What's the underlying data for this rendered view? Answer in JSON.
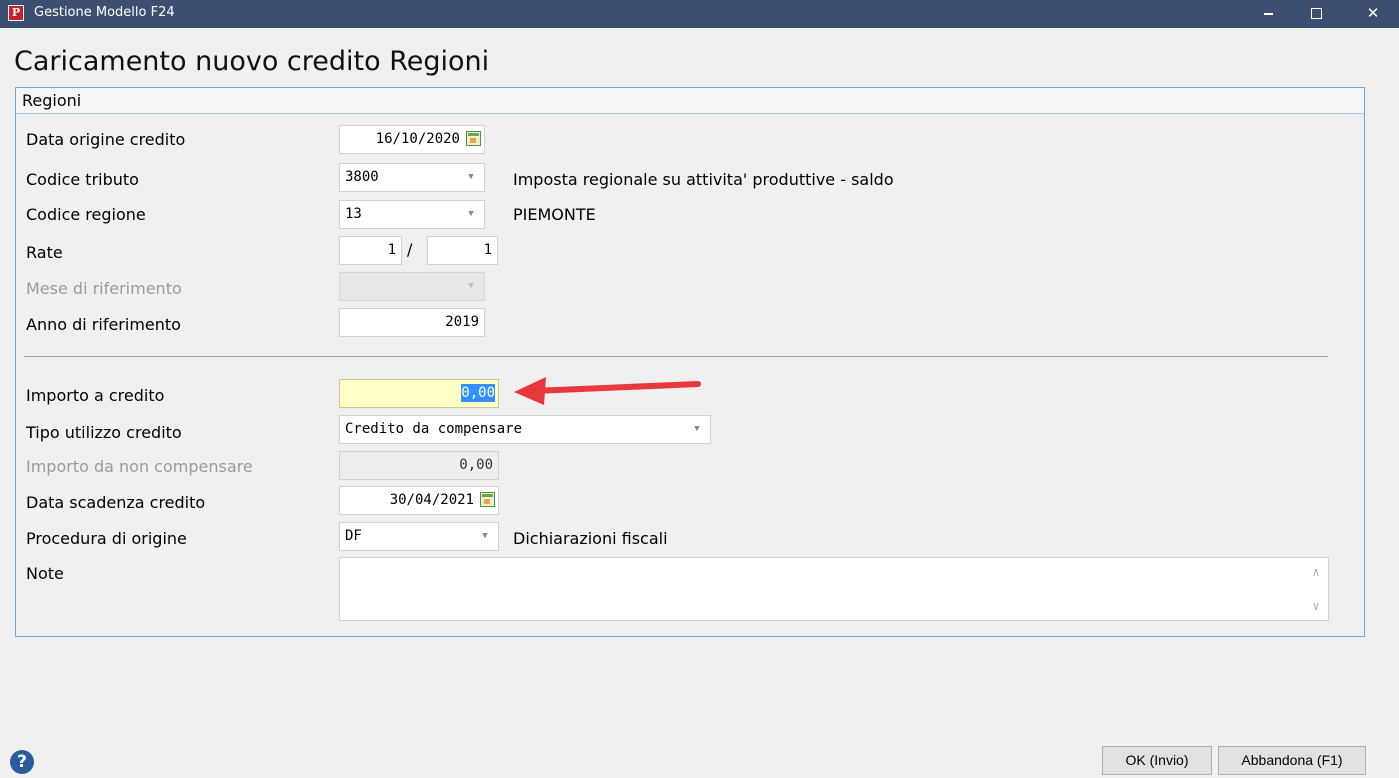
{
  "window": {
    "app_icon_letter": "P",
    "title": "Gestione Modello F24",
    "minimize": "minimize-icon",
    "maximize": "maximize-icon",
    "close": "✕"
  },
  "page": {
    "title": "Caricamento nuovo credito Regioni"
  },
  "group": {
    "title": "Regioni"
  },
  "form": {
    "data_origine": {
      "label": "Data origine credito",
      "value": "16/10/2020"
    },
    "codice_tributo": {
      "label": "Codice tributo",
      "value": "3800",
      "description": "Imposta regionale su attivita' produttive - saldo"
    },
    "codice_regione": {
      "label": "Codice regione",
      "value": "13",
      "description": "PIEMONTE"
    },
    "rate": {
      "label": "Rate",
      "current": "1",
      "separator": "/",
      "total": "1"
    },
    "mese_riferimento": {
      "label": "Mese di riferimento",
      "value": "",
      "enabled": false
    },
    "anno_riferimento": {
      "label": "Anno di riferimento",
      "value": "2019"
    },
    "importo_credito": {
      "label": "Importo a credito",
      "value": "0,00"
    },
    "tipo_utilizzo": {
      "label": "Tipo utilizzo credito",
      "value": "Credito da compensare"
    },
    "importo_non_compensare": {
      "label": "Importo da non compensare",
      "value": "0,00",
      "enabled": false
    },
    "data_scadenza": {
      "label": "Data scadenza credito",
      "value": "30/04/2021"
    },
    "procedura_origine": {
      "label": "Procedura di origine",
      "value": "DF",
      "description": "Dichiarazioni fiscali"
    },
    "note": {
      "label": "Note",
      "value": ""
    }
  },
  "annotation": {
    "arrow_color": "#e8383b"
  },
  "footer": {
    "help": "?",
    "ok_label": "OK (Invio)",
    "cancel_label": "Abbandona (F1)"
  },
  "colors": {
    "titlebar": "#3c4f70",
    "group_border": "#6fa8dc",
    "focus_field": "#ffffc6",
    "selection": "#3390ff"
  }
}
